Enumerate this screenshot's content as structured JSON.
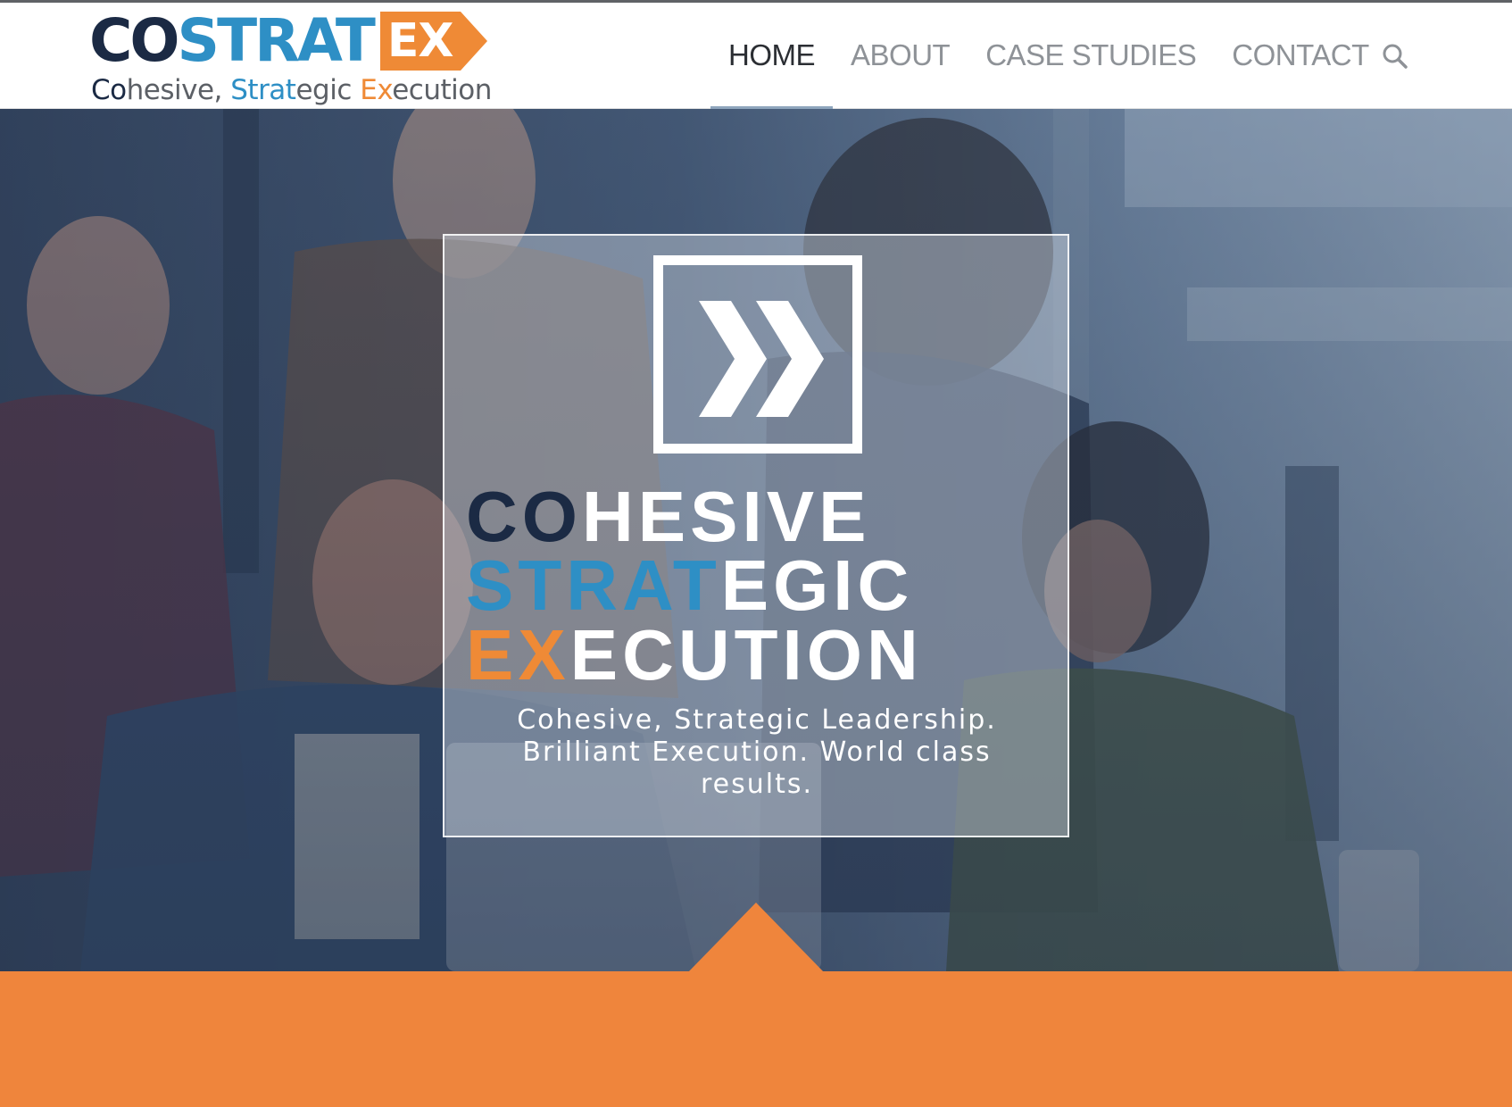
{
  "brand": {
    "mark_co": "CO",
    "mark_strat": "STRAT",
    "mark_ex": "EX",
    "tagline": {
      "co": "Co",
      "hesive": "hesive, ",
      "strat": "Strat",
      "egic": "egic ",
      "ex": "Ex",
      "ecution": "ecution"
    }
  },
  "nav": {
    "items": [
      {
        "label": "HOME",
        "active": true
      },
      {
        "label": "ABOUT",
        "active": false
      },
      {
        "label": "CASE STUDIES",
        "active": false
      },
      {
        "label": "CONTACT",
        "active": false
      }
    ],
    "search_icon": "search-icon"
  },
  "hero": {
    "icon": "double-chevron-right-icon",
    "line1_accent": "CO",
    "line1_rest": "HESIVE",
    "line2_accent": "STRAT",
    "line2_rest": "EGIC",
    "line3_accent": "EX",
    "line3_rest": "ECUTION",
    "subtitle": "Cohesive, Strategic Leadership. Brilliant Execution. World class results."
  },
  "colors": {
    "navy": "#1b2a44",
    "blue": "#2e8fc5",
    "orange": "#ef8a36",
    "band": "#ef853c"
  }
}
